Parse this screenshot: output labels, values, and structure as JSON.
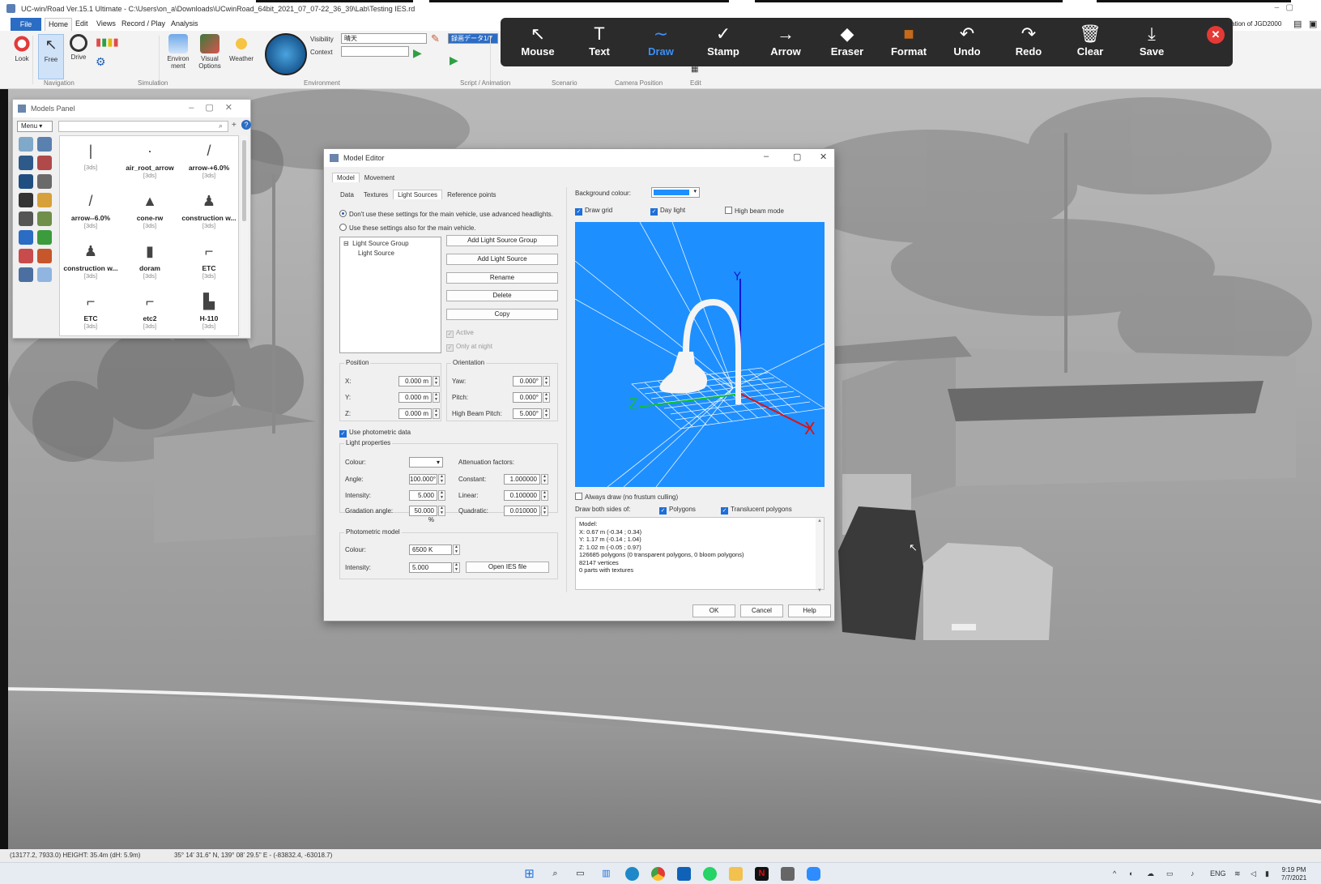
{
  "app": {
    "title": "UC-win/Road Ver.15.1 Ultimate - C:\\Users\\on_a\\Downloads\\UCwinRoad_64bit_2021_07_07-22_36_39\\Lab\\Testing IES.rd",
    "right_label": "ation of JGD2000"
  },
  "menu": {
    "file": "File",
    "items": [
      "Home",
      "Edit",
      "Views",
      "Record / Play",
      "Analysis"
    ]
  },
  "ribbon": {
    "buttons": {
      "look": "Look",
      "free": "Free",
      "drive": "Drive",
      "environment": "Environ ment",
      "visual_options": "Visual Options",
      "weather": "Weather"
    },
    "groups": {
      "navigation": "Navigation",
      "simulation": "Simulation",
      "environment": "Environment",
      "script_animation": "Script / Animation",
      "scenario": "Scenario",
      "camera_position": "Camera Position",
      "edit": "Edit"
    },
    "visibility_label": "Visibility",
    "visibility_value": "晴天",
    "context_label": "Context",
    "context_value": "",
    "script_value": "録画データ1/7"
  },
  "annotation_toolbar": {
    "tools": [
      {
        "label": "Mouse",
        "icon": "↖",
        "active": false
      },
      {
        "label": "Text",
        "icon": "T",
        "active": false
      },
      {
        "label": "Draw",
        "icon": "∼",
        "active": true
      },
      {
        "label": "Stamp",
        "icon": "✓",
        "active": false
      },
      {
        "label": "Arrow",
        "icon": "→",
        "active": false
      },
      {
        "label": "Eraser",
        "icon": "◆",
        "active": false
      },
      {
        "label": "Format",
        "icon": "■",
        "active": false
      },
      {
        "label": "Undo",
        "icon": "↶",
        "active": false
      },
      {
        "label": "Redo",
        "icon": "↷",
        "active": false
      },
      {
        "label": "Clear",
        "icon": "🗑",
        "active": false
      },
      {
        "label": "Save",
        "icon": "⤓",
        "active": false
      }
    ],
    "close_icon": "✕",
    "format_color": "#c46a1a"
  },
  "models_panel": {
    "title": "Models Panel",
    "menu_label": "Menu",
    "search_placeholder": "",
    "items": [
      {
        "name": "",
        "format": "[3ds]",
        "icon": "|"
      },
      {
        "name": "air_root_arrow",
        "format": "[3ds]",
        "icon": "·"
      },
      {
        "name": "arrow-+6.0%",
        "format": "[3ds]",
        "icon": "/"
      },
      {
        "name": "arrow--6.0%",
        "format": "[3ds]",
        "icon": "/"
      },
      {
        "name": "cone-rw",
        "format": "[3ds]",
        "icon": "▲"
      },
      {
        "name": "construction w...",
        "format": "[3ds]",
        "icon": "♟"
      },
      {
        "name": "construction w...",
        "format": "[3ds]",
        "icon": "♟"
      },
      {
        "name": "doram",
        "format": "[3ds]",
        "icon": "▮"
      },
      {
        "name": "ETC",
        "format": "[3ds]",
        "icon": "⌐"
      },
      {
        "name": "ETC",
        "format": "[3ds]",
        "icon": "⌐"
      },
      {
        "name": "etc2",
        "format": "[3ds]",
        "icon": "⌐"
      },
      {
        "name": "H-110",
        "format": "[3ds]",
        "icon": "▙"
      }
    ]
  },
  "model_editor": {
    "title": "Model Editor",
    "top_tabs": [
      "Model",
      "Movement"
    ],
    "sub_tabs": [
      "Data",
      "Textures",
      "Light Sources",
      "Reference points"
    ],
    "radio_1": "Don't use these settings for the main vehicle, use advanced headlights.",
    "radio_2": "Use these settings also for the main vehicle.",
    "tree": {
      "group": "Light Source Group",
      "child": "Light Source"
    },
    "buttons": {
      "add_group": "Add Light Source Group",
      "add_source": "Add Light Source",
      "rename": "Rename",
      "delete": "Delete",
      "copy": "Copy"
    },
    "active_label": "Active",
    "night_label": "Only at night",
    "position": {
      "title": "Position",
      "x_label": "X:",
      "x": "0.000 m",
      "y_label": "Y:",
      "y": "0.000 m",
      "z_label": "Z:",
      "z": "0.000 m"
    },
    "orientation": {
      "title": "Orientation",
      "yaw_label": "Yaw:",
      "yaw": "0.000°",
      "pitch_label": "Pitch:",
      "pitch": "0.000°",
      "hb_label": "High Beam Pitch:",
      "hb": "5.000°"
    },
    "use_photometric": "Use photometric data",
    "light_props": {
      "title": "Light properties",
      "colour_label": "Colour:",
      "angle_label": "Angle:",
      "angle": "100.000°",
      "intensity_label": "Intensity:",
      "intensity": "5.000",
      "gradation_label": "Gradation angle:",
      "gradation": "50.000 %",
      "atten_label": "Attenuation factors:",
      "constant_label": "Constant:",
      "constant": "1.000000",
      "linear_label": "Linear:",
      "linear": "0.100000",
      "quadratic_label": "Quadratic:",
      "quadratic": "0.010000"
    },
    "photometric": {
      "title": "Photometric model",
      "colour_label": "Colour:",
      "colour": "6500 K",
      "intensity_label": "Intensity:",
      "intensity": "5.000",
      "open_ies": "Open IES file"
    },
    "bg_colour_label": "Background colour:",
    "bg_colour": "#1e8fff",
    "draw_grid": "Draw grid",
    "day_light": "Day light",
    "high_beam": "High beam mode",
    "always_draw": "Always draw (no frustum culling)",
    "draw_both": "Draw both sides of:",
    "polygons": "Polygons",
    "translucent": "Translucent polygons",
    "info_lines": [
      "Model:",
      "X: 0.67 m (-0.34 ; 0.34)",
      "Y: 1.17 m (-0.14 ; 1.04)",
      "Z: 1.02 m (-0.05 ; 0.97)",
      "126685 polygons (0 transparent polygons, 0 bloom polygons)",
      "82147 vertices",
      "0 parts with textures"
    ],
    "axis_labels": {
      "x": "X",
      "y": "Y",
      "z": "Z"
    },
    "ok": "OK",
    "cancel": "Cancel",
    "help": "Help"
  },
  "status": {
    "coords": "(13177.2, 7933.0) HEIGHT: 35.4m (dH: 5.9m)",
    "latlon": "35° 14' 31.6\" N, 139° 08' 29.5\" E  -  (-83832.4, -63018.7)"
  },
  "tray": {
    "lang": "ENG",
    "time": "9:19 PM",
    "date": "7/7/2021"
  }
}
